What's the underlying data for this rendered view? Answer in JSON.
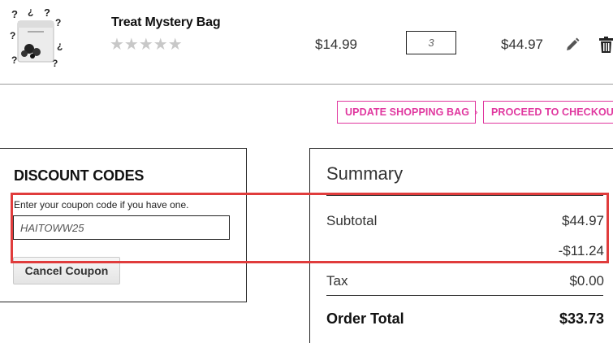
{
  "cart_item": {
    "name": "Treat Mystery Bag",
    "rating_stars": "★★★★★",
    "rating_filled": 0,
    "price": "$14.99",
    "quantity": "3",
    "row_subtotal": "$44.97",
    "edit_icon": "pencil-icon",
    "delete_icon": "trash-icon"
  },
  "actions": {
    "update_label": "UPDATE SHOPPING BAG",
    "checkout_label": "PROCEED TO CHECKOUT",
    "chevron": "›",
    "accent_color": "#e0379f"
  },
  "discount": {
    "title": "DISCOUNT CODES",
    "hint": "Enter your coupon code if you have one.",
    "code_value": "HAITOWW25",
    "cancel_label": "Cancel Coupon"
  },
  "summary": {
    "title": "Summary",
    "subtotal_label": "Subtotal",
    "subtotal_value": "$44.97",
    "discount_value": "-$11.24",
    "tax_label": "Tax",
    "tax_value": "$0.00",
    "order_total_label": "Order Total",
    "order_total_value": "$33.73"
  },
  "highlight_color": "#e03c3c"
}
